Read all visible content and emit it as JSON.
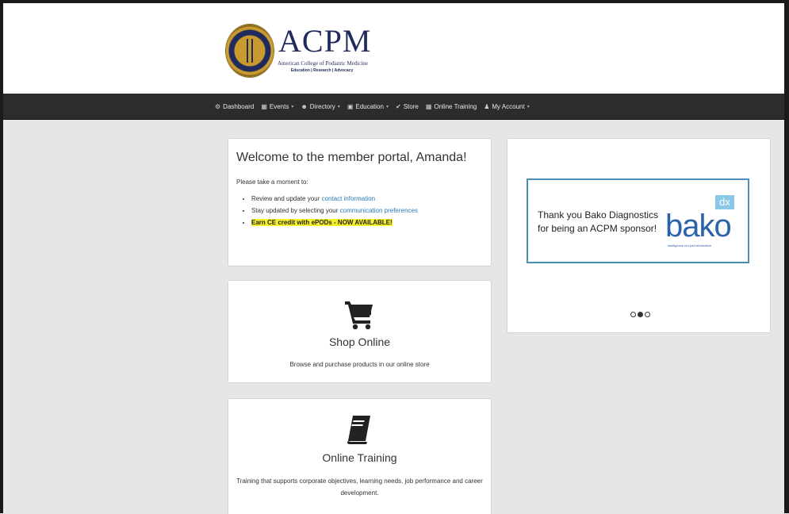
{
  "header": {
    "logo_title": "ACPM",
    "logo_subtitle": "American College of Podiatric Medicine",
    "logo_tagline": "Education | Research | Advocacy"
  },
  "nav": {
    "items": [
      {
        "label": "Dashboard",
        "icon": "dashboard-icon",
        "dropdown": false
      },
      {
        "label": "Events",
        "icon": "calendar-icon",
        "dropdown": true
      },
      {
        "label": "Directory",
        "icon": "users-icon",
        "dropdown": true
      },
      {
        "label": "Education",
        "icon": "book-icon",
        "dropdown": true
      },
      {
        "label": "Store",
        "icon": "cart-icon",
        "dropdown": false
      },
      {
        "label": "Online Training",
        "icon": "grid-icon",
        "dropdown": false
      },
      {
        "label": "My Account",
        "icon": "user-icon",
        "dropdown": true
      }
    ]
  },
  "welcome": {
    "title": "Welcome to the member portal, Amanda!",
    "intro": "Please take a moment to:",
    "item1_prefix": "Review and update your ",
    "item1_link": "contact information",
    "item2_prefix": "Stay updated by selecting your ",
    "item2_link": "communication preferences",
    "item3_highlight": "Earn CE credit with ePODs - NOW AVAILABLE!"
  },
  "carousel": {
    "slide_line1": "Thank you Bako Diagnostics",
    "slide_line2": "for being an ACPM sponsor!",
    "sponsor_logo": "bako",
    "sponsor_badge": "dx",
    "sponsor_tagline": "intelligence not just information",
    "active_index": 1,
    "slide_count": 3
  },
  "tiles": {
    "shop": {
      "title": "Shop Online",
      "description": "Browse and purchase products in our online store",
      "icon": "cart-icon"
    },
    "training": {
      "title": "Online Training",
      "description": "Training that supports corporate objectives, learning needs, job performance and career development.",
      "icon": "book-icon"
    }
  },
  "colors": {
    "navbar": "#2c2c2c",
    "link": "#2a7ab8",
    "highlight": "#f5f22a",
    "brand_navy": "#1f2b5c",
    "sponsor_blue": "#2a63a8"
  }
}
